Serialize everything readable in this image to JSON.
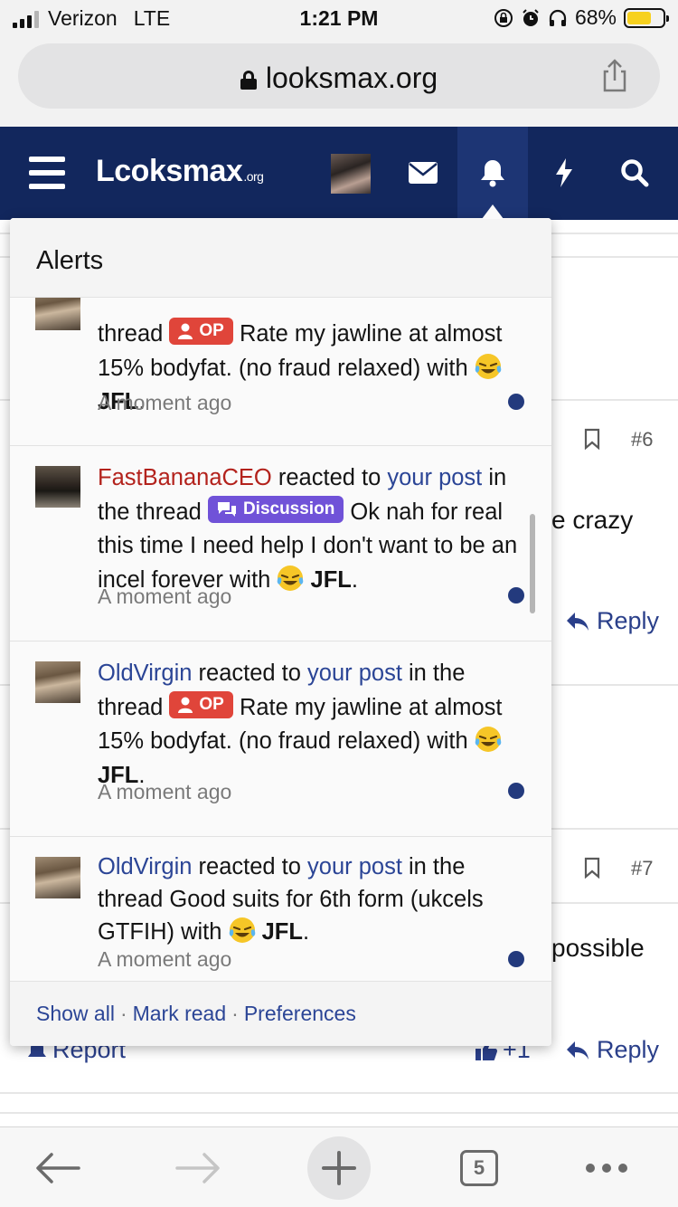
{
  "status_bar": {
    "carrier": "Verizon",
    "network": "LTE",
    "time": "1:21 PM",
    "battery_text": "68%",
    "battery_level": 0.68,
    "battery_color": "#f7d11e"
  },
  "browser": {
    "url": "looksmax.org"
  },
  "site": {
    "logo_main": "Lcoksmax",
    "logo_suffix": ".org",
    "nav_color": "#12275d"
  },
  "background_thread": {
    "post_numbers": [
      "#6",
      "#7"
    ],
    "fragments": [
      "e crazy",
      "possible"
    ],
    "reply_label": "Reply",
    "report_label": "Report",
    "like_count": "+1"
  },
  "alerts": {
    "title": "Alerts",
    "items": [
      {
        "user": "",
        "pre": "thread",
        "badge": "OP",
        "thread": "Rate my jawline at almost 15% bodyfat. (no fraud relaxed)",
        "with": "with",
        "reaction": "JFL",
        "time": "A moment ago"
      },
      {
        "user": "FastBananaCEO",
        "verb": "reacted to",
        "target": "your post",
        "in": "in the thread",
        "badge": "Discussion",
        "thread": "Ok nah for real this time I need help I don't want to be an incel forever",
        "with": "with",
        "reaction": "JFL",
        "time": "A moment ago"
      },
      {
        "user": "OldVirgin",
        "verb": "reacted to",
        "target": "your post",
        "in": "in the thread",
        "badge": "OP",
        "thread": "Rate my jawline at almost 15% bodyfat. (no fraud relaxed)",
        "with": "with",
        "reaction": "JFL",
        "time": "A moment ago"
      },
      {
        "user": "OldVirgin",
        "verb": "reacted to",
        "target": "your post",
        "in": "in the thread",
        "thread": "Good suits for 6th form (ukcels GTFIH)",
        "with": "with",
        "reaction": "JFL",
        "time": "A moment ago"
      }
    ],
    "footer": {
      "show_all": "Show all",
      "mark_read": "Mark read",
      "preferences": "Preferences",
      "separator": "·"
    }
  },
  "toolbar": {
    "tab_count": "5"
  }
}
